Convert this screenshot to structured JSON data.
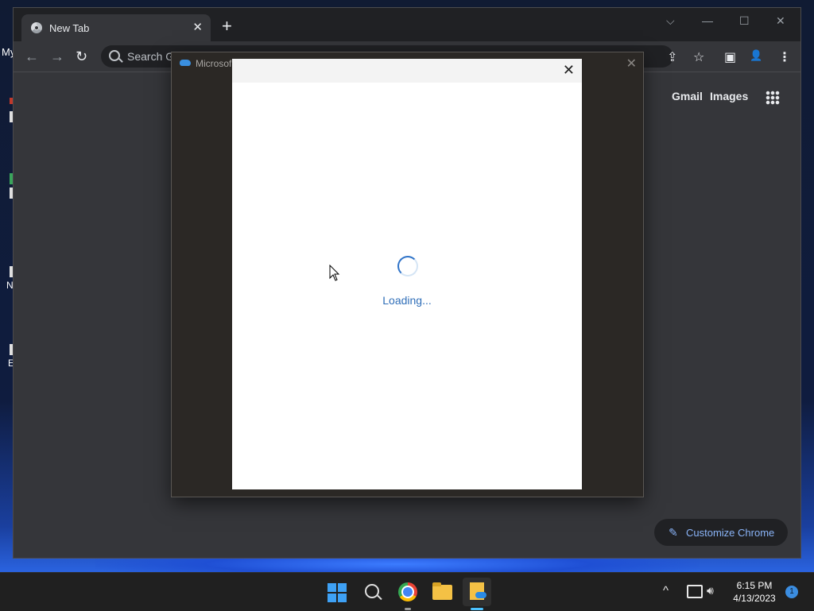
{
  "desktop": {
    "icon_label_my": "My",
    "icon_label_n": "N",
    "icon_label_e": "E"
  },
  "browser": {
    "tab_title": "New Tab",
    "tab_close": "✕",
    "new_tab": "+",
    "window_controls": {
      "dropdown": "⌵",
      "minimize": "—",
      "maximize": "☐",
      "close": "✕"
    },
    "nav": {
      "back": "←",
      "forward": "→",
      "reload": "↻"
    },
    "omnibox_placeholder": "Search Go",
    "toolbar_icons": {
      "share": "⇪",
      "bookmark": "☆",
      "sidepanel": "▣",
      "profile": "👤",
      "menu": "⋮"
    },
    "ntp": {
      "gmail": "Gmail",
      "images": "Images",
      "customize_label": "Customize Chrome",
      "customize_icon": "✎"
    }
  },
  "onedrive_dialog": {
    "outer_title": "Microsof",
    "outer_close": "✕",
    "inner_close": "✕",
    "loading_text": "Loading..."
  },
  "taskbar": {
    "apps": [
      "start",
      "search",
      "chrome",
      "file-explorer",
      "onedrive-setup"
    ],
    "tray_chevron": "^",
    "clock_time": "6:15 PM",
    "clock_date": "4/13/2023",
    "notification_count": "1"
  },
  "colors": {
    "chrome_frame": "#202124",
    "chrome_body": "#35363a",
    "accent_blue": "#8ab4f8",
    "loading_blue": "#2f6eb8",
    "taskbar": "#202020"
  }
}
